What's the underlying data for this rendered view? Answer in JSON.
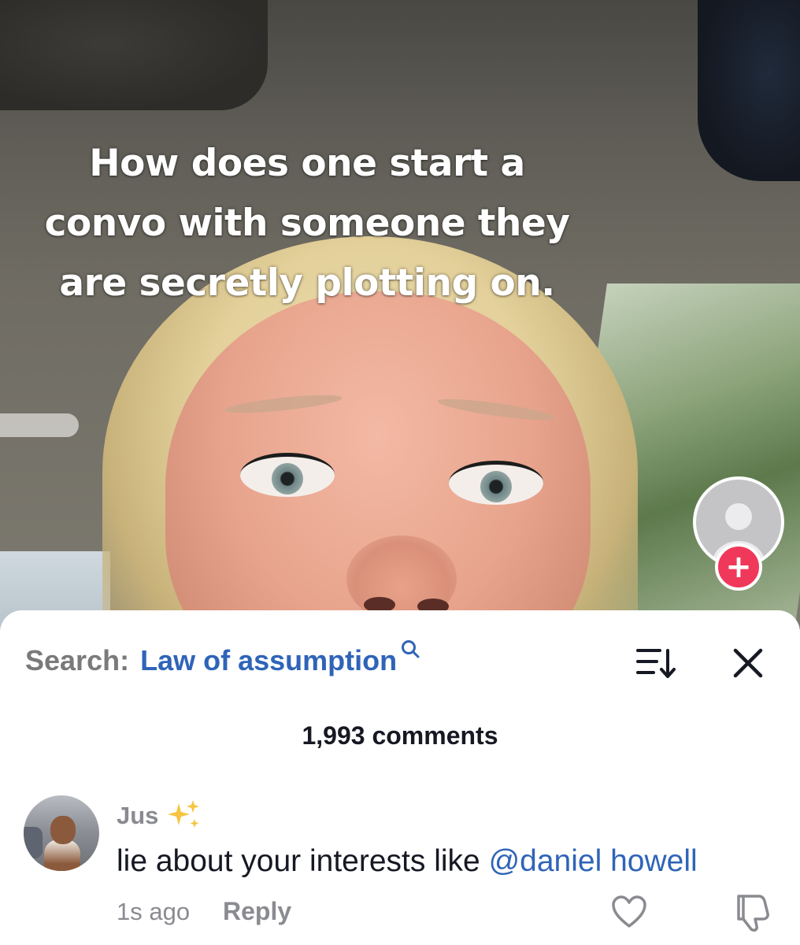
{
  "video": {
    "caption_lines": [
      "How does one start a",
      "convo with someone they",
      "are secretly plotting on."
    ],
    "follow_button_symbol": "+"
  },
  "comments_panel": {
    "search_label": "Search:",
    "search_term": "Law of assumption",
    "search_icon": "search-icon",
    "sort_icon": "sort-icon",
    "close_icon": "close-icon",
    "comments_count": "1,993 comments"
  },
  "comment": {
    "username": "Jus",
    "username_emoji": "sparkles-icon",
    "text": "lie about your interests like ",
    "mention": "@daniel howell",
    "timestamp": "1s ago",
    "reply_label": "Reply",
    "like_icon": "heart-icon",
    "dislike_icon": "thumbs-down-icon"
  },
  "colors": {
    "accent_blue": "#2f64b8",
    "follow_red": "#f0385a",
    "muted_text": "#8a8b91",
    "primary_text": "#161823"
  }
}
